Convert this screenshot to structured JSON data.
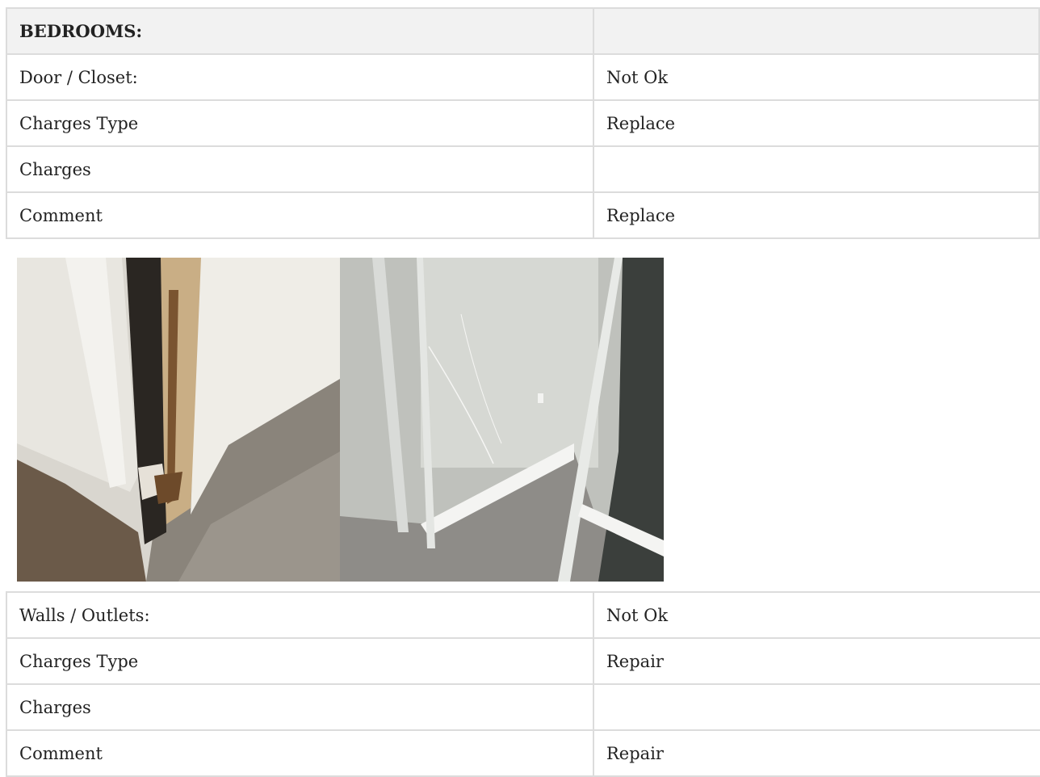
{
  "section": {
    "title": "BEDROOMS:",
    "title_value": ""
  },
  "group1": {
    "rows": [
      {
        "label": "Door / Closet:",
        "value": "Not Ok"
      },
      {
        "label": "Charges Type",
        "value": "Replace"
      },
      {
        "label": "Charges",
        "value": ""
      },
      {
        "label": "Comment",
        "value": "Replace"
      }
    ]
  },
  "photos": [
    {
      "name": "damaged-door-frame-photo"
    },
    {
      "name": "cracked-mirror-closet-door-photo"
    }
  ],
  "group2": {
    "rows": [
      {
        "label": "Walls / Outlets:",
        "value": "Not Ok"
      },
      {
        "label": "Charges Type",
        "value": "Repair"
      },
      {
        "label": "Charges",
        "value": ""
      },
      {
        "label": "Comment",
        "value": "Repair"
      }
    ]
  }
}
